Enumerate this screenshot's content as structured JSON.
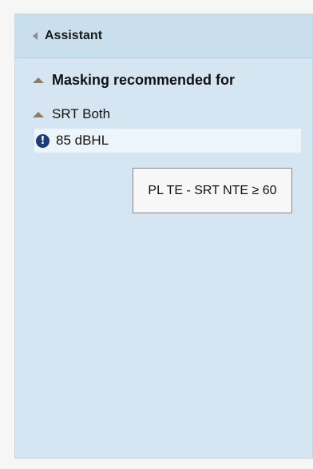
{
  "panel": {
    "title": "Assistant",
    "collapse_icon": "chevron-left-icon"
  },
  "sections": [
    {
      "label": "Masking recommended for",
      "icon": "triangle-up-icon"
    },
    {
      "label": "SRT Both",
      "icon": "triangle-up-icon"
    }
  ],
  "item": {
    "icon": "exclamation-circle-icon",
    "icon_glyph": "!",
    "label": "85 dBHL"
  },
  "tooltip": {
    "text": "PL TE - SRT NTE ≥ 60"
  }
}
